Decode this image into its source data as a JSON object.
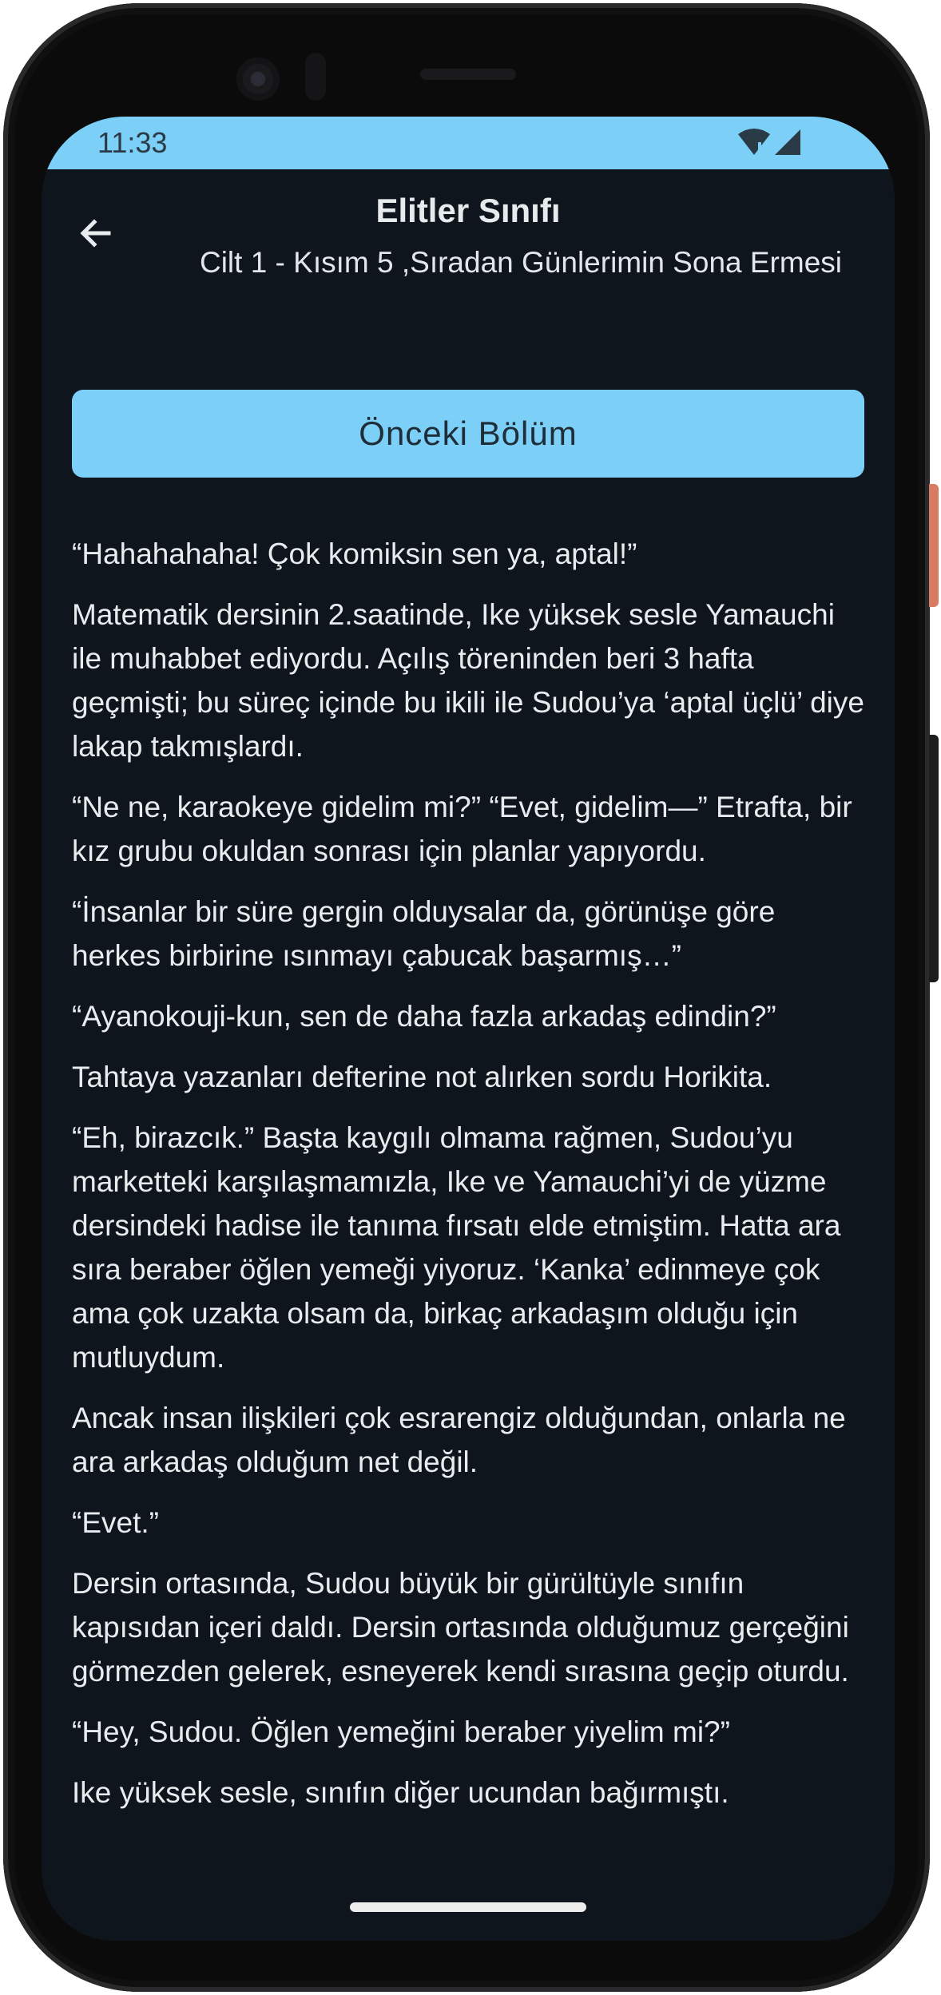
{
  "status_bar": {
    "time": "11:33",
    "background_color": "#7ccff7",
    "icons": [
      "wifi-alert-icon",
      "cell-signal-icon"
    ]
  },
  "header": {
    "title": "Elitler Sınıfı",
    "subtitle": "Cilt 1 - Kısım 5 ,Sıradan Günlerimin Sona Ermesi",
    "back_icon": "arrow-left-icon"
  },
  "prev_chapter_label": "Önceki Bölüm",
  "accent_color": "#7ccff7",
  "screen_background": "#0f151c",
  "paragraphs": [
    "“Hahahahaha! Çok komiksin sen ya, aptal!”",
    "Matematik dersinin 2.saatinde, Ike yüksek sesle Yamauchi ile muhabbet ediyordu. Açılış töreninden beri 3 hafta geçmişti; bu süreç içinde bu ikili ile Sudou’ya ‘aptal üçlü’ diye lakap takmışlardı.",
    "“Ne ne, karaokeye gidelim mi?” “Evet, gidelim—” Etrafta, bir kız grubu okuldan sonrası için planlar yapıyordu.",
    "“İnsanlar bir süre gergin olduysalar da, görünüşe göre herkes birbirine ısınmayı çabucak başarmış…”",
    "“Ayanokouji-kun, sen de daha fazla arkadaş edindin?”",
    "Tahtaya yazanları defterine not alırken sordu Horikita.",
    "“Eh, birazcık.” Başta kaygılı olmama rağmen, Sudou’yu marketteki karşılaşmamızla, Ike ve Yamauchi’yi de yüzme dersindeki hadise ile tanıma fırsatı elde etmiştim. Hatta ara sıra beraber öğlen yemeği yiyoruz. ‘Kanka’ edinmeye çok ama çok uzakta olsam da, birkaç arkadaşım olduğu için mutluydum.",
    "Ancak insan ilişkileri çok esrarengiz olduğundan, onlarla ne ara arkadaş olduğum net değil.",
    "“Evet.”",
    "Dersin ortasında, Sudou büyük bir gürültüyle sınıfın kapısıdan içeri daldı. Dersin ortasında olduğumuz gerçeğini görmezden gelerek, esneyerek kendi sırasına geçip oturdu.",
    "“Hey, Sudou. Öğlen yemeğini beraber yiyelim mi?”",
    "Ike yüksek sesle, sınıfın diğer ucundan bağırmıştı."
  ]
}
